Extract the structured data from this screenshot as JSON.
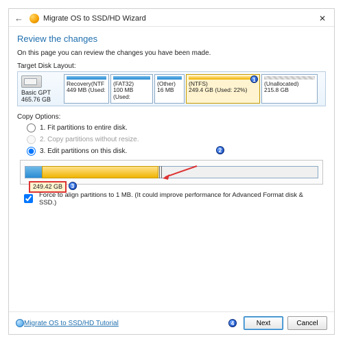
{
  "window": {
    "title": "Migrate OS to SSD/HD Wizard",
    "close": "✕",
    "back": "←"
  },
  "heading": "Review the changes",
  "description": "On this page you can review the changes you have been made.",
  "target_label": "Target Disk Layout:",
  "disk": {
    "line1": "Basic GPT",
    "line2": "465.76 GB"
  },
  "partitions": [
    {
      "l1": "Recovery(NTF",
      "l2": "449 MB (Used:"
    },
    {
      "l1": "(FAT32)",
      "l2": "100 MB (Used:"
    },
    {
      "l1": "(Other)",
      "l2": "16 MB"
    },
    {
      "l1": "(NTFS)",
      "l2": "249.4 GB (Used: 22%)",
      "selected": true,
      "badge": "1"
    },
    {
      "l1": "(Unallocated)",
      "l2": "215.8 GB",
      "unalloc": true
    }
  ],
  "copy_label": "Copy Options:",
  "options": {
    "o1": "1. Fit partitions to entire disk.",
    "o2": "2. Copy partitions without resize.",
    "o3": "3. Edit partitions on this disk."
  },
  "editor": {
    "size_chip": "249.42 GB",
    "badge2": "2",
    "badge3": "3"
  },
  "force_label": "Force to align partitions to 1 MB.  (It could improve performance for Advanced Format disk & SSD.)",
  "footer": {
    "tutorial": "Migrate OS to SSD/HD Tutorial",
    "next": "Next",
    "cancel": "Cancel",
    "badge4": "4"
  }
}
